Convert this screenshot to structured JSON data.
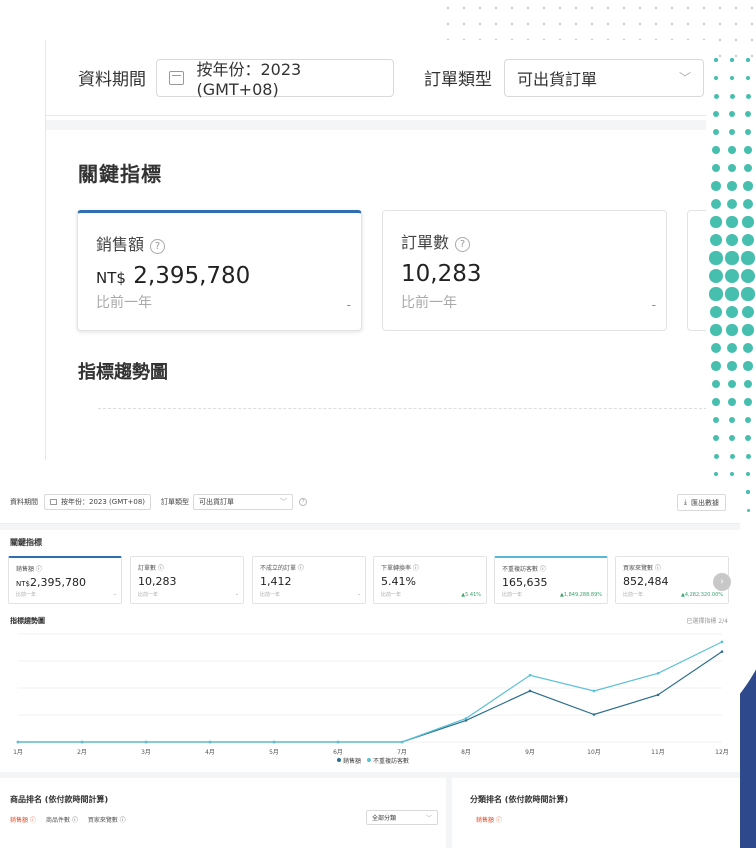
{
  "filter": {
    "period_label": "資料期間",
    "period_value": "按年份：2023 (GMT+08)",
    "order_type_label": "訂單類型",
    "order_type_value": "可出貨訂單",
    "export_label": "匯出數據"
  },
  "kpi_section_title": "關鍵指標",
  "trend_section_title": "指標趨勢圖",
  "selected_metrics_label": "已選擇指標 2/4",
  "compare_label": "比前一年",
  "kpis": [
    {
      "name": "銷售額",
      "currency": "NT$",
      "value": "2,395,780",
      "change": "-"
    },
    {
      "name": "訂單數",
      "currency": "",
      "value": "10,283",
      "change": "-"
    },
    {
      "name": "不成立的訂單",
      "currency": "",
      "value": "1,412",
      "change": "-"
    },
    {
      "name": "下單轉換率",
      "currency": "",
      "value": "5.41%",
      "change": "▲5.41%"
    },
    {
      "name": "不重複訪客數",
      "currency": "",
      "value": "165,635",
      "change": "▲1,849,288.89%"
    },
    {
      "name": "買家來覽數",
      "currency": "",
      "value": "852,484",
      "change": "▲4,282,320.00%"
    }
  ],
  "chart_data": {
    "type": "line",
    "categories": [
      "1月",
      "2月",
      "3月",
      "4月",
      "5月",
      "6月",
      "7月",
      "8月",
      "9月",
      "10月",
      "11月",
      "12月"
    ],
    "series": [
      {
        "name": "銷售額",
        "color": "#2d6e8e",
        "values": [
          0,
          0,
          0,
          0,
          0,
          0,
          0,
          22,
          52,
          28,
          48,
          92
        ]
      },
      {
        "name": "不重複訪客數",
        "color": "#5bc1d6",
        "values": [
          0,
          0,
          0,
          0,
          0,
          0,
          0,
          24,
          68,
          52,
          70,
          102
        ]
      }
    ],
    "ylim": [
      0,
      110
    ],
    "grid": true,
    "legend": "bottom"
  },
  "ranking": {
    "product_title": "商品排名 (依付款時間計算)",
    "product_tabs": [
      "銷售額",
      "商品件數",
      "買家來覽數"
    ],
    "category_select": "全部分類",
    "category_title": "分類排名 (依付款時間計算)",
    "category_tabs": [
      "銷售額"
    ]
  },
  "colors": {
    "accent": "#2f6fb0",
    "deco_green": "#47bfae",
    "deco_navy": "#2e4a8c",
    "positive": "#37a56b"
  }
}
